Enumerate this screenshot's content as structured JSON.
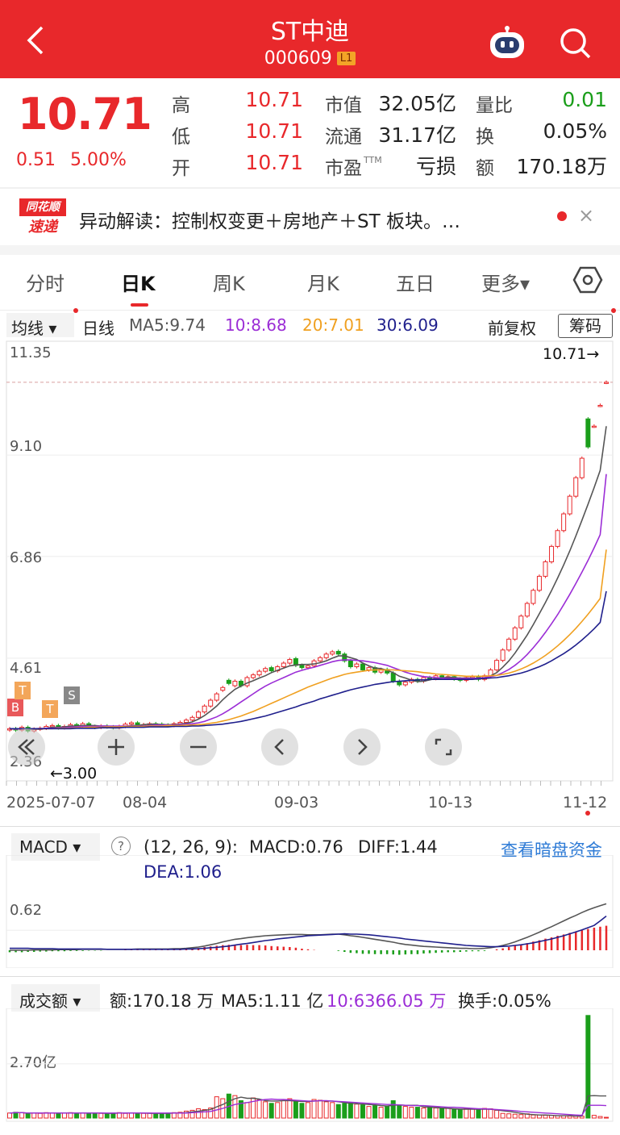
{
  "header": {
    "title": "ST中迪",
    "code": "000609",
    "level_badge": "L1",
    "back_icon": "chevron-left-icon",
    "assistant_icon": "robot-icon",
    "search_icon": "search-icon",
    "bg_color": "#e8282b"
  },
  "quote": {
    "price": "10.71",
    "change": "0.51",
    "change_pct": "5.00%",
    "high_label": "高",
    "high": "10.71",
    "low_label": "低",
    "low": "10.71",
    "open_label": "开",
    "open": "10.71",
    "mktcap_label": "市值",
    "mktcap": "32.05亿",
    "float_label": "流通",
    "float": "31.17亿",
    "pe_label": "市盈",
    "pe_sup": "TTM",
    "pe": "亏损",
    "volratio_label": "量比",
    "volratio": "0.01",
    "turnover_label": "换",
    "turnover": "0.05%",
    "amount_label": "额",
    "amount": "170.18万",
    "up_color": "#e8282b",
    "down_color": "#1a9e1a"
  },
  "news": {
    "logo_line1": "同花顺",
    "logo_line2": "速递",
    "text": "异动解读：控制权变更＋房地产＋ST 板块。…",
    "close": "×"
  },
  "tabs": [
    {
      "label": "分时"
    },
    {
      "label": "日K"
    },
    {
      "label": "周K"
    },
    {
      "label": "月K"
    },
    {
      "label": "五日"
    },
    {
      "label": "更多▾"
    }
  ],
  "settings_icon": "hexagon-settings-icon",
  "ma_bar": {
    "selector": "均线 ▾",
    "period": "日线",
    "ma5": "MA5:9.74",
    "ma10": "10:8.68",
    "ma20": "20:7.01",
    "ma30": "30:6.09",
    "adjust": "前复权",
    "chips": "筹码",
    "colors": {
      "ma5": "#555555",
      "ma10": "#9b2dd6",
      "ma20": "#f0a020",
      "ma30": "#1f1f8c"
    }
  },
  "kline": {
    "y_ticks": [
      "11.35",
      "9.10",
      "6.86",
      "4.61",
      "2.36"
    ],
    "latest_marker": "10.71→",
    "low_marker": "←3.00",
    "x_ticks": [
      "2025-07-07",
      "08-04",
      "09-03",
      "10-13",
      "11-12"
    ],
    "signals": [
      "B",
      "T",
      "T",
      "S"
    ]
  },
  "chart_data": {
    "type": "candlestick",
    "ylim": [
      2.36,
      11.35
    ],
    "close": [
      3.05,
      3.02,
      3.08,
      3.0,
      3.04,
      3.06,
      3.1,
      3.12,
      3.07,
      3.1,
      3.14,
      3.12,
      3.16,
      3.1,
      3.08,
      3.11,
      3.09,
      3.07,
      3.1,
      3.15,
      3.18,
      3.12,
      3.14,
      3.16,
      3.15,
      3.13,
      3.12,
      3.16,
      3.19,
      3.24,
      3.3,
      3.42,
      3.55,
      3.68,
      3.82,
      3.96,
      4.05,
      4.1,
      4.0,
      4.18,
      4.24,
      4.32,
      4.38,
      4.33,
      4.42,
      4.5,
      4.58,
      4.45,
      4.4,
      4.44,
      4.55,
      4.62,
      4.7,
      4.75,
      4.7,
      4.55,
      4.42,
      4.48,
      4.35,
      4.4,
      4.3,
      4.36,
      4.28,
      4.1,
      4.02,
      4.08,
      4.14,
      4.1,
      4.18,
      4.16,
      4.22,
      4.18,
      4.2,
      4.15,
      4.12,
      4.18,
      4.2,
      4.14,
      4.22,
      4.35,
      4.56,
      4.79,
      5.03,
      5.28,
      5.54,
      5.82,
      6.11,
      6.42,
      6.74,
      7.08,
      7.43,
      7.8,
      8.19,
      8.6,
      9.03,
      9.28,
      9.74,
      10.2,
      10.71
    ],
    "open": [
      3.02,
      3.05,
      3.02,
      3.08,
      3.0,
      3.04,
      3.06,
      3.1,
      3.12,
      3.07,
      3.1,
      3.14,
      3.12,
      3.16,
      3.1,
      3.08,
      3.11,
      3.09,
      3.07,
      3.1,
      3.15,
      3.18,
      3.12,
      3.14,
      3.16,
      3.15,
      3.13,
      3.12,
      3.16,
      3.19,
      3.24,
      3.3,
      3.42,
      3.55,
      3.68,
      3.9,
      4.12,
      4.0,
      4.1,
      4.0,
      4.18,
      4.24,
      4.32,
      4.4,
      4.33,
      4.42,
      4.5,
      4.6,
      4.45,
      4.4,
      4.44,
      4.55,
      4.62,
      4.7,
      4.76,
      4.7,
      4.55,
      4.42,
      4.48,
      4.35,
      4.4,
      4.3,
      4.36,
      4.28,
      4.1,
      4.02,
      4.08,
      4.14,
      4.1,
      4.18,
      4.16,
      4.22,
      4.18,
      4.2,
      4.15,
      4.12,
      4.18,
      4.2,
      4.14,
      4.22,
      4.35,
      4.56,
      4.79,
      5.03,
      5.28,
      5.54,
      5.82,
      6.11,
      6.42,
      6.74,
      7.08,
      7.43,
      7.8,
      8.19,
      8.6,
      9.9,
      9.74,
      10.2,
      10.71
    ],
    "series": [
      {
        "name": "MA5",
        "values": [
          3.05,
          3.04,
          3.05,
          3.04,
          3.04,
          3.04,
          3.06,
          3.08,
          3.08,
          3.09,
          3.11,
          3.11,
          3.12,
          3.12,
          3.12,
          3.11,
          3.11,
          3.09,
          3.09,
          3.1,
          3.12,
          3.12,
          3.14,
          3.15,
          3.15,
          3.14,
          3.14,
          3.14,
          3.15,
          3.17,
          3.2,
          3.26,
          3.34,
          3.44,
          3.55,
          3.69,
          3.81,
          3.92,
          3.99,
          4.06,
          4.11,
          4.17,
          4.22,
          4.29,
          4.34,
          4.39,
          4.44,
          4.46,
          4.47,
          4.47,
          4.48,
          4.51,
          4.55,
          4.61,
          4.66,
          4.66,
          4.62,
          4.58,
          4.5,
          4.44,
          4.39,
          4.38,
          4.34,
          4.29,
          4.21,
          4.17,
          4.12,
          4.09,
          4.1,
          4.13,
          4.16,
          4.17,
          4.19,
          4.18,
          4.17,
          4.17,
          4.17,
          4.16,
          4.17,
          4.22,
          4.29,
          4.41,
          4.55,
          4.72,
          4.92,
          5.12,
          5.35,
          5.59,
          5.84,
          6.1,
          6.38,
          6.67,
          6.98,
          7.31,
          7.66,
          8.01,
          8.38,
          8.76,
          9.74
        ]
      },
      {
        "name": "MA10",
        "values": [
          3.05,
          3.04,
          3.05,
          3.05,
          3.05,
          3.05,
          3.06,
          3.06,
          3.07,
          3.07,
          3.08,
          3.09,
          3.1,
          3.1,
          3.1,
          3.11,
          3.11,
          3.11,
          3.11,
          3.11,
          3.11,
          3.11,
          3.11,
          3.12,
          3.13,
          3.13,
          3.13,
          3.13,
          3.14,
          3.15,
          3.16,
          3.18,
          3.21,
          3.26,
          3.31,
          3.38,
          3.46,
          3.55,
          3.64,
          3.73,
          3.82,
          3.91,
          3.99,
          4.06,
          4.12,
          4.18,
          4.24,
          4.3,
          4.34,
          4.38,
          4.41,
          4.45,
          4.49,
          4.53,
          4.56,
          4.57,
          4.57,
          4.56,
          4.55,
          4.53,
          4.51,
          4.48,
          4.45,
          4.4,
          4.35,
          4.3,
          4.26,
          4.23,
          4.2,
          4.19,
          4.18,
          4.17,
          4.16,
          4.16,
          4.16,
          4.16,
          4.16,
          4.17,
          4.18,
          4.2,
          4.23,
          4.29,
          4.36,
          4.45,
          4.56,
          4.69,
          4.84,
          5.0,
          5.18,
          5.37,
          5.57,
          5.79,
          6.02,
          6.26,
          6.51,
          6.77,
          7.05,
          7.34,
          8.68
        ]
      },
      {
        "name": "MA20",
        "values": [
          3.05,
          3.05,
          3.05,
          3.05,
          3.05,
          3.05,
          3.05,
          3.05,
          3.06,
          3.06,
          3.06,
          3.07,
          3.07,
          3.08,
          3.08,
          3.08,
          3.09,
          3.09,
          3.09,
          3.1,
          3.1,
          3.1,
          3.1,
          3.11,
          3.11,
          3.11,
          3.12,
          3.12,
          3.12,
          3.13,
          3.13,
          3.14,
          3.15,
          3.17,
          3.19,
          3.22,
          3.25,
          3.29,
          3.33,
          3.38,
          3.43,
          3.49,
          3.55,
          3.61,
          3.67,
          3.73,
          3.79,
          3.85,
          3.91,
          3.97,
          4.02,
          4.07,
          4.12,
          4.17,
          4.21,
          4.25,
          4.28,
          4.3,
          4.32,
          4.34,
          4.35,
          4.35,
          4.35,
          4.35,
          4.34,
          4.33,
          4.32,
          4.31,
          4.29,
          4.28,
          4.26,
          4.25,
          4.24,
          4.23,
          4.22,
          4.21,
          4.21,
          4.21,
          4.21,
          4.22,
          4.23,
          4.25,
          4.28,
          4.32,
          4.37,
          4.43,
          4.5,
          4.58,
          4.67,
          4.77,
          4.88,
          5.0,
          5.13,
          5.27,
          5.42,
          5.58,
          5.75,
          5.93,
          7.01
        ]
      },
      {
        "name": "MA30",
        "values": [
          3.05,
          3.05,
          3.05,
          3.05,
          3.05,
          3.05,
          3.05,
          3.05,
          3.05,
          3.05,
          3.05,
          3.06,
          3.06,
          3.06,
          3.06,
          3.07,
          3.07,
          3.07,
          3.07,
          3.08,
          3.08,
          3.08,
          3.08,
          3.09,
          3.09,
          3.09,
          3.09,
          3.1,
          3.1,
          3.1,
          3.11,
          3.11,
          3.12,
          3.13,
          3.14,
          3.15,
          3.17,
          3.19,
          3.21,
          3.24,
          3.27,
          3.3,
          3.33,
          3.37,
          3.41,
          3.45,
          3.49,
          3.53,
          3.58,
          3.62,
          3.66,
          3.71,
          3.75,
          3.79,
          3.83,
          3.87,
          3.91,
          3.94,
          3.97,
          4.0,
          4.03,
          4.05,
          4.07,
          4.09,
          4.1,
          4.11,
          4.12,
          4.13,
          4.13,
          4.14,
          4.14,
          4.14,
          4.14,
          4.14,
          4.14,
          4.14,
          4.14,
          4.15,
          4.16,
          4.17,
          4.18,
          4.2,
          4.22,
          4.25,
          4.28,
          4.32,
          4.37,
          4.42,
          4.48,
          4.55,
          4.63,
          4.71,
          4.8,
          4.9,
          5.01,
          5.13,
          5.26,
          5.4,
          6.09
        ]
      }
    ]
  },
  "macd": {
    "selector": "MACD ▾",
    "help": "?",
    "params": "(12, 26, 9):",
    "macd": "MACD:0.76",
    "diff": "DIFF:1.44",
    "dea": "DEA:1.06",
    "link": "查看暗盘资金",
    "y_tick": "0.62",
    "hist": [
      -0.06,
      -0.06,
      -0.06,
      -0.05,
      -0.05,
      -0.04,
      -0.04,
      -0.03,
      -0.03,
      -0.03,
      -0.02,
      -0.02,
      -0.02,
      -0.01,
      -0.01,
      -0.01,
      0,
      0,
      0,
      0.01,
      0.01,
      0.01,
      0.01,
      0.01,
      0.01,
      0.01,
      0.01,
      0.02,
      0.02,
      0.03,
      0.05,
      0.07,
      0.1,
      0.12,
      0.14,
      0.16,
      0.17,
      0.17,
      0.16,
      0.17,
      0.16,
      0.16,
      0.15,
      0.13,
      0.12,
      0.11,
      0.1,
      0.08,
      0.05,
      0.03,
      0.01,
      0,
      0,
      0,
      -0.02,
      -0.05,
      -0.08,
      -0.09,
      -0.11,
      -0.11,
      -0.12,
      -0.12,
      -0.12,
      -0.13,
      -0.14,
      -0.13,
      -0.12,
      -0.12,
      -0.1,
      -0.09,
      -0.08,
      -0.07,
      -0.06,
      -0.06,
      -0.05,
      -0.04,
      -0.03,
      -0.03,
      -0.02,
      0,
      0.03,
      0.06,
      0.1,
      0.14,
      0.18,
      0.22,
      0.27,
      0.31,
      0.36,
      0.4,
      0.45,
      0.49,
      0.54,
      0.58,
      0.62,
      0.66,
      0.7,
      0.73,
      0.76
    ],
    "diff_line": [
      0,
      0,
      0,
      0,
      0.01,
      0.01,
      0.01,
      0.01,
      0.02,
      0.02,
      0.02,
      0.02,
      0.03,
      0.03,
      0.03,
      0.03,
      0.03,
      0.03,
      0.03,
      0.03,
      0.03,
      0.04,
      0.04,
      0.04,
      0.04,
      0.04,
      0.04,
      0.05,
      0.05,
      0.06,
      0.08,
      0.1,
      0.13,
      0.17,
      0.21,
      0.26,
      0.3,
      0.34,
      0.36,
      0.39,
      0.41,
      0.43,
      0.45,
      0.46,
      0.47,
      0.48,
      0.49,
      0.49,
      0.49,
      0.48,
      0.48,
      0.48,
      0.49,
      0.5,
      0.5,
      0.48,
      0.45,
      0.43,
      0.4,
      0.37,
      0.34,
      0.31,
      0.28,
      0.25,
      0.21,
      0.18,
      0.16,
      0.14,
      0.12,
      0.11,
      0.1,
      0.09,
      0.08,
      0.07,
      0.06,
      0.06,
      0.05,
      0.05,
      0.06,
      0.08,
      0.11,
      0.15,
      0.2,
      0.26,
      0.33,
      0.4,
      0.48,
      0.56,
      0.65,
      0.73,
      0.82,
      0.91,
      1.0,
      1.08,
      1.17,
      1.25,
      1.32,
      1.38,
      1.44
    ],
    "dea_line": [
      0.06,
      0.06,
      0.06,
      0.06,
      0.05,
      0.05,
      0.05,
      0.05,
      0.04,
      0.04,
      0.04,
      0.04,
      0.04,
      0.04,
      0.04,
      0.04,
      0.03,
      0.03,
      0.03,
      0.03,
      0.03,
      0.03,
      0.03,
      0.03,
      0.03,
      0.03,
      0.03,
      0.03,
      0.03,
      0.04,
      0.04,
      0.05,
      0.06,
      0.08,
      0.09,
      0.11,
      0.13,
      0.16,
      0.19,
      0.21,
      0.24,
      0.27,
      0.3,
      0.32,
      0.35,
      0.37,
      0.39,
      0.41,
      0.43,
      0.45,
      0.46,
      0.47,
      0.48,
      0.49,
      0.5,
      0.51,
      0.5,
      0.5,
      0.49,
      0.48,
      0.46,
      0.44,
      0.42,
      0.4,
      0.38,
      0.35,
      0.33,
      0.31,
      0.29,
      0.27,
      0.25,
      0.23,
      0.21,
      0.19,
      0.17,
      0.15,
      0.14,
      0.13,
      0.12,
      0.11,
      0.11,
      0.12,
      0.13,
      0.15,
      0.17,
      0.2,
      0.23,
      0.27,
      0.31,
      0.35,
      0.4,
      0.45,
      0.51,
      0.57,
      0.63,
      0.7,
      0.77,
      0.91,
      1.06
    ]
  },
  "volume": {
    "selector": "成交额 ▾",
    "amount": "额:170.18 万",
    "ma5": "MA5:1.11 亿",
    "ma10": "10:6366.05 万",
    "turnover": "换手:0.05%",
    "y_tick": "2.70亿",
    "values": [
      0.13,
      0.15,
      0.14,
      0.12,
      0.13,
      0.12,
      0.14,
      0.13,
      0.12,
      0.13,
      0.14,
      0.12,
      0.13,
      0.12,
      0.13,
      0.12,
      0.12,
      0.13,
      0.14,
      0.12,
      0.13,
      0.12,
      0.12,
      0.13,
      0.12,
      0.12,
      0.13,
      0.14,
      0.15,
      0.18,
      0.2,
      0.24,
      0.22,
      0.26,
      0.55,
      0.5,
      0.62,
      0.58,
      0.45,
      0.4,
      0.52,
      0.48,
      0.42,
      0.38,
      0.4,
      0.45,
      0.5,
      0.44,
      0.38,
      0.4,
      0.48,
      0.46,
      0.42,
      0.4,
      0.35,
      0.38,
      0.4,
      0.36,
      0.34,
      0.3,
      0.32,
      0.28,
      0.3,
      0.45,
      0.34,
      0.3,
      0.28,
      0.28,
      0.26,
      0.3,
      0.26,
      0.24,
      0.25,
      0.22,
      0.22,
      0.24,
      0.24,
      0.22,
      0.25,
      0.24,
      0.2,
      0.12,
      0.11,
      0.1,
      0.09,
      0.11,
      0.08,
      0.08,
      0.07,
      0.07,
      0.06,
      0.06,
      0.05,
      0.05,
      0.05,
      2.65,
      0.07,
      0.04,
      0.02
    ],
    "ma5_line": [
      0.13,
      0.14,
      0.14,
      0.13,
      0.13,
      0.13,
      0.13,
      0.13,
      0.13,
      0.13,
      0.13,
      0.13,
      0.13,
      0.13,
      0.13,
      0.13,
      0.12,
      0.12,
      0.13,
      0.13,
      0.13,
      0.13,
      0.13,
      0.12,
      0.12,
      0.12,
      0.12,
      0.13,
      0.13,
      0.14,
      0.16,
      0.18,
      0.2,
      0.22,
      0.29,
      0.35,
      0.43,
      0.5,
      0.54,
      0.51,
      0.51,
      0.49,
      0.45,
      0.44,
      0.44,
      0.45,
      0.45,
      0.44,
      0.43,
      0.43,
      0.44,
      0.45,
      0.44,
      0.44,
      0.42,
      0.4,
      0.38,
      0.37,
      0.36,
      0.35,
      0.34,
      0.32,
      0.31,
      0.33,
      0.34,
      0.33,
      0.33,
      0.33,
      0.29,
      0.28,
      0.27,
      0.26,
      0.25,
      0.24,
      0.23,
      0.23,
      0.23,
      0.23,
      0.23,
      0.23,
      0.21,
      0.19,
      0.17,
      0.15,
      0.12,
      0.1,
      0.09,
      0.08,
      0.08,
      0.07,
      0.06,
      0.06,
      0.06,
      0.05,
      0.05,
      0.57,
      0.58,
      0.57,
      0.57
    ],
    "ma10_line": [
      0.13,
      0.14,
      0.14,
      0.13,
      0.13,
      0.13,
      0.13,
      0.13,
      0.13,
      0.13,
      0.13,
      0.13,
      0.13,
      0.13,
      0.13,
      0.13,
      0.13,
      0.13,
      0.13,
      0.13,
      0.13,
      0.13,
      0.13,
      0.13,
      0.13,
      0.13,
      0.13,
      0.13,
      0.13,
      0.13,
      0.14,
      0.15,
      0.16,
      0.17,
      0.21,
      0.25,
      0.3,
      0.35,
      0.38,
      0.4,
      0.43,
      0.46,
      0.48,
      0.49,
      0.48,
      0.48,
      0.47,
      0.46,
      0.45,
      0.44,
      0.44,
      0.45,
      0.45,
      0.44,
      0.43,
      0.42,
      0.41,
      0.4,
      0.39,
      0.38,
      0.37,
      0.36,
      0.35,
      0.35,
      0.34,
      0.33,
      0.32,
      0.32,
      0.32,
      0.31,
      0.3,
      0.29,
      0.28,
      0.28,
      0.27,
      0.26,
      0.25,
      0.24,
      0.24,
      0.23,
      0.22,
      0.21,
      0.2,
      0.19,
      0.17,
      0.16,
      0.15,
      0.14,
      0.13,
      0.12,
      0.11,
      0.1,
      0.09,
      0.08,
      0.07,
      0.33,
      0.33,
      0.33,
      0.32
    ]
  }
}
